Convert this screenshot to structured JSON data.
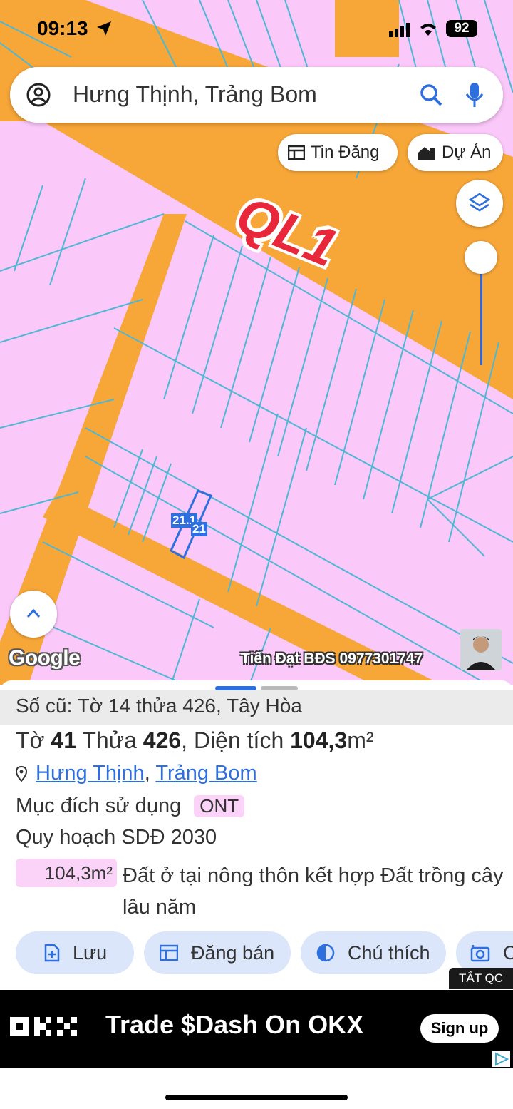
{
  "status": {
    "time": "09:13",
    "battery": "92"
  },
  "search": {
    "text": "Hưng Thịnh, Trảng Bom"
  },
  "chips": {
    "listings": "Tin Đăng",
    "projects": "Dự Án"
  },
  "map": {
    "road_label": "QL1",
    "parcel_label_1": "21.1",
    "parcel_label_2": "21",
    "google": "Google",
    "watermark": "Tiến Đạt BĐS 0977301747"
  },
  "sheet": {
    "old_info": "Số cũ: Tờ 14 thửa 426, Tây Hòa",
    "sheet_prefix": "Tờ ",
    "sheet_no": "41",
    "parcel_prefix": " Thửa ",
    "parcel_no": "426",
    "area_prefix": ", Diện tích ",
    "area": "104,3",
    "area_unit": "m²",
    "ward": "Hưng Thịnh",
    "comma": ",",
    "district": "Trảng Bom",
    "purpose_label": "Mục đích sử dụng",
    "purpose_code": "ONT",
    "plan_label": "Quy hoạch SDĐ 2030",
    "plan_area": "104,3m²",
    "plan_desc": "Đất ở tại nông thôn kết hợp Đất trồng cây lâu năm"
  },
  "actions": {
    "save": "Lưu",
    "sell": "Đăng bán",
    "legend": "Chú thích",
    "more": "C"
  },
  "ad": {
    "close_label": "TẮT QC",
    "brand": "OKX",
    "headline": "Trade $Dash On OKX",
    "cta": "Sign up"
  },
  "colors": {
    "land": "#fbc8fa",
    "road": "#f7a638",
    "parcel_line": "#4db7d6",
    "accent": "#2e6fe0",
    "ql1": "#e8283a"
  }
}
